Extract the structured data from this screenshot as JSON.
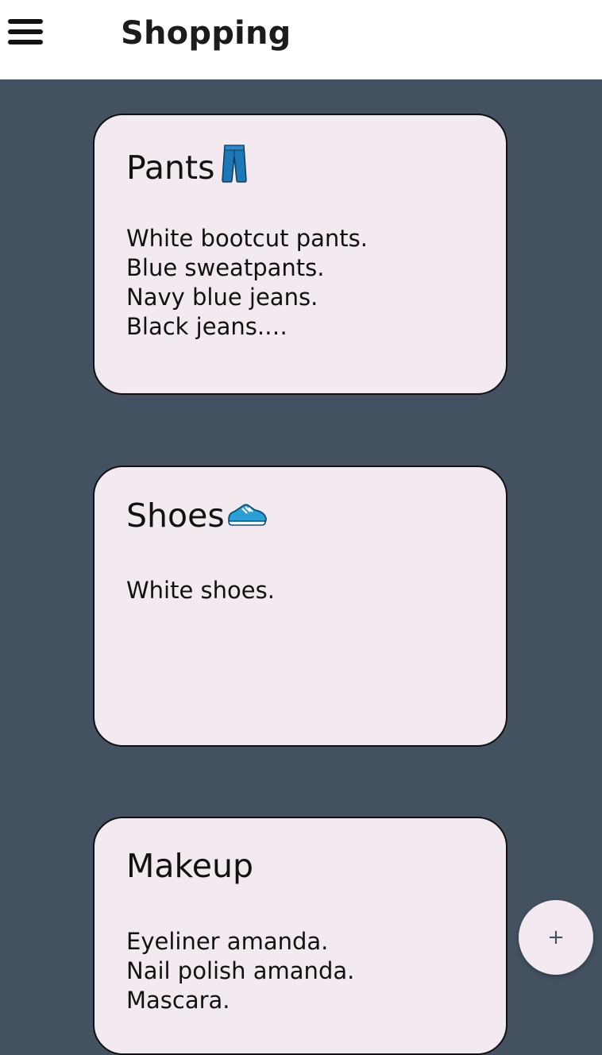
{
  "header": {
    "title": "Shopping",
    "menu_icon": "hamburger-menu-icon"
  },
  "cards": [
    {
      "title": "Pants",
      "icon": "jeans-icon",
      "lines": [
        "White bootcut pants.",
        "Blue sweatpants.",
        "Navy blue jeans.",
        "Black jeans.…"
      ]
    },
    {
      "title": "Shoes",
      "icon": "sneaker-icon",
      "lines": [
        "White shoes."
      ]
    },
    {
      "title": "Makeup",
      "icon": "",
      "lines": [
        "Eyeliner amanda.",
        "Nail polish amanda.",
        "Mascara."
      ]
    }
  ],
  "fab": {
    "label": "+"
  },
  "colors": {
    "background": "#435161",
    "app_bar": "#ffffff",
    "card": "#f3eaf1",
    "border": "#111111",
    "jeans": "#1f77b4",
    "sneaker": "#2b9fd6"
  }
}
